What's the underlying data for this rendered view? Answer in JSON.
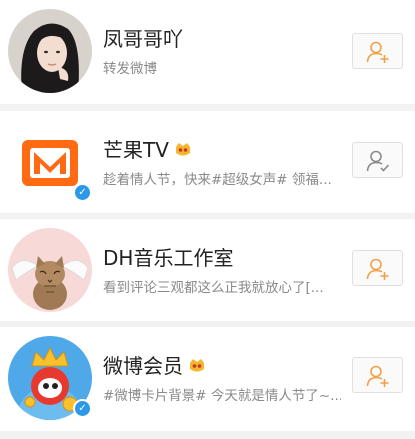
{
  "users": [
    {
      "name": "凤哥哥吖",
      "description": "转发微博",
      "verified": false,
      "has_badge": false,
      "follow_state": "add",
      "avatar_icon": "girl-portrait-avatar"
    },
    {
      "name": "芒果TV",
      "description": "趁着情人节，快来#超级女声# 领福...",
      "verified": true,
      "has_badge": true,
      "follow_state": "following",
      "avatar_icon": "mango-tv-logo"
    },
    {
      "name": "DH音乐工作室",
      "description": "看到评论三观都这么正我就放心了[...",
      "verified": false,
      "has_badge": false,
      "follow_state": "add",
      "avatar_icon": "winged-cat-avatar"
    },
    {
      "name": "微博会员",
      "description": "#微博卡片背景# 今天就是情人节了~...",
      "verified": true,
      "has_badge": true,
      "follow_state": "add",
      "avatar_icon": "weibo-vip-mascot"
    }
  ],
  "colors": {
    "add_icon": "#f0a045",
    "following_icon": "#8a8a8a",
    "verified": "#2a9ae8",
    "badge": "#f7b52c",
    "mango": "#ff6a13"
  }
}
